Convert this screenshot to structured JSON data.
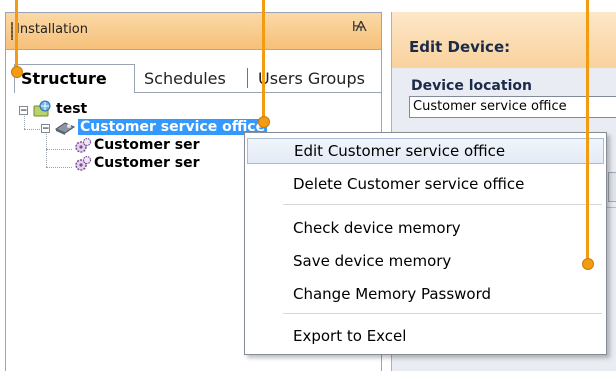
{
  "panel": {
    "title": "Installation",
    "pin_glyph": "Ѩ"
  },
  "tabs": [
    {
      "label": "Structure",
      "active": true
    },
    {
      "label": "Schedules",
      "active": false
    },
    {
      "label": "Users Groups",
      "active": false
    }
  ],
  "tree": {
    "root": {
      "label": "test",
      "expanded": true
    },
    "selected": {
      "label": "Customer service office",
      "expanded": true
    },
    "children": [
      {
        "label": "Customer ser"
      },
      {
        "label": "Customer ser"
      }
    ]
  },
  "edit": {
    "title": "Edit Device:",
    "field_label": "Device location",
    "field_value": "Customer service office"
  },
  "context_menu": {
    "items": [
      {
        "label": "Edit Customer service office",
        "hover": true
      },
      {
        "label": "Delete Customer service office"
      },
      {
        "label": "Check device memory"
      },
      {
        "label": "Save device memory"
      },
      {
        "label": "Change Memory Password"
      },
      {
        "label": "Export to Excel"
      }
    ]
  },
  "colors": {
    "accent": "#f39c12",
    "header_orange": "#f6c07a",
    "selection": "#3399ff"
  },
  "icons": {
    "root": "network-folder-icon",
    "device": "device-icon",
    "child": "gear-cluster-icon"
  }
}
